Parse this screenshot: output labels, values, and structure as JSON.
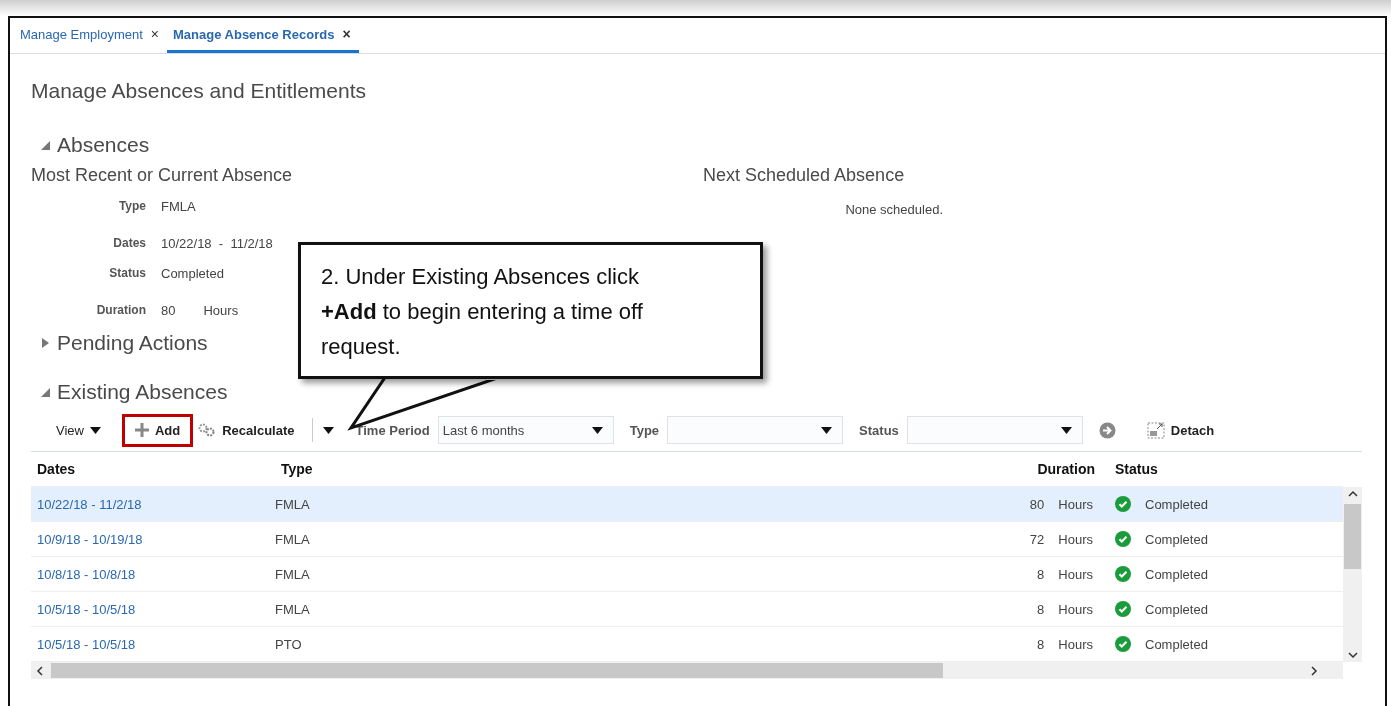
{
  "tabs": [
    {
      "label": "Manage Employment",
      "close": "×",
      "selected": false
    },
    {
      "label": "Manage Absence Records",
      "close": "×",
      "selected": true
    }
  ],
  "page_title": "Manage Absences and Entitlements",
  "absences": {
    "title": "Absences",
    "expanded": true,
    "current": {
      "title": "Most Recent or Current Absence",
      "fields": [
        {
          "label": "Type",
          "value": "FMLA"
        },
        {
          "label": "Dates",
          "value": "10/22/18  -  11/2/18"
        },
        {
          "label": "Status",
          "value": "Completed"
        },
        {
          "label": "Duration",
          "value": "80",
          "unit": "Hours"
        }
      ]
    },
    "next": {
      "title": "Next Scheduled Absence",
      "text": "None scheduled."
    }
  },
  "pending": {
    "title": "Pending Actions",
    "expanded": false
  },
  "existing": {
    "title": "Existing Absences",
    "expanded": true,
    "toolbar": {
      "view": "View",
      "add": "Add",
      "add_highlighted": true,
      "recalculate": "Recalculate",
      "filters": [
        {
          "label": "Time Period",
          "value": "Last 6 months"
        },
        {
          "label": "Type"
        },
        {
          "label": "Status"
        }
      ],
      "detach": "Detach"
    },
    "columns": [
      "Dates",
      "Type",
      "Duration",
      "Status"
    ],
    "rows": [
      {
        "dates": "10/22/18 - 11/2/18",
        "type": "FMLA",
        "duration": "80",
        "unit": "Hours",
        "status": "Completed",
        "selected": true
      },
      {
        "dates": "10/9/18 - 10/19/18",
        "type": "FMLA",
        "duration": "72",
        "unit": "Hours",
        "status": "Completed",
        "selected": false
      },
      {
        "dates": "10/8/18 - 10/8/18",
        "type": "FMLA",
        "duration": "8",
        "unit": "Hours",
        "status": "Completed",
        "selected": false
      },
      {
        "dates": "10/5/18 - 10/5/18",
        "type": "FMLA",
        "duration": "8",
        "unit": "Hours",
        "status": "Completed",
        "selected": false
      },
      {
        "dates": "10/5/18 - 10/5/18",
        "type": "PTO",
        "duration": "8",
        "unit": "Hours",
        "status": "Completed",
        "selected": false
      }
    ]
  },
  "callout": {
    "text": "2. Under Existing Absences click **+Add** to begin entering a time off request."
  }
}
